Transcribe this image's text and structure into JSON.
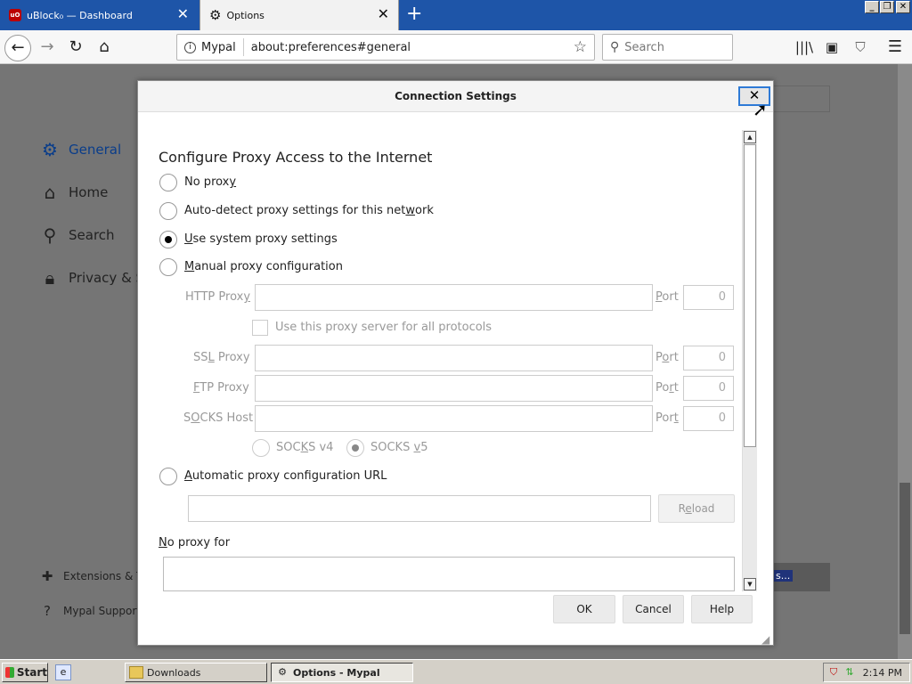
{
  "browser": {
    "tabs": [
      {
        "label": "uBlock₀ — Dashboard",
        "icon": "ublock-icon"
      },
      {
        "label": "Options",
        "icon": "gear-icon"
      }
    ],
    "new_tab": "+",
    "window_controls": {
      "minimize": "_",
      "restore": "❐",
      "close": "✕"
    },
    "identity": "Mypal",
    "url": "about:preferences#general",
    "search_placeholder": "Search"
  },
  "preferences": {
    "sidebar": [
      {
        "label": "General",
        "icon": "gear-icon",
        "selected": true
      },
      {
        "label": "Home",
        "icon": "home-icon"
      },
      {
        "label": "Search",
        "icon": "search-icon"
      },
      {
        "label": "Privacy & Se",
        "icon": "lock-icon"
      }
    ],
    "footer": [
      {
        "label": "Extensions & T",
        "icon": "puzzle-icon"
      },
      {
        "label": "Mypal Support",
        "icon": "help-icon"
      }
    ],
    "partial_button": "s..."
  },
  "dialog": {
    "title": "Connection Settings",
    "heading": "Configure Proxy Access to the Internet",
    "options": {
      "no_proxy": {
        "pre": "No prox",
        "key": "y",
        "post": ""
      },
      "auto_detect": {
        "pre": "Auto-detect proxy settings for this net",
        "key": "w",
        "post": "ork"
      },
      "system": {
        "pre": "",
        "key": "U",
        "post": "se system proxy settings"
      },
      "manual": {
        "pre": "",
        "key": "M",
        "post": "anual proxy configuration"
      },
      "auto_url": {
        "pre": "",
        "key": "A",
        "post": "utomatic proxy configuration URL"
      }
    },
    "selected_option": "system",
    "http_proxy": {
      "label": "HTTP Prox",
      "key": "y",
      "port_label_pre": "",
      "port_key": "P",
      "port_label_post": "ort",
      "port": "0"
    },
    "share": {
      "label": "Use this proxy server for all protocols"
    },
    "ssl_proxy": {
      "label_pre": "SS",
      "key": "L",
      "label_post": " Proxy",
      "port_label_pre": "P",
      "port_key": "o",
      "port_label_post": "rt",
      "port": "0"
    },
    "ftp_proxy": {
      "label_pre": "",
      "key": "F",
      "label_post": "TP Proxy",
      "port_label_pre": "Po",
      "port_key": "r",
      "port_label_post": "t",
      "port": "0"
    },
    "socks_host": {
      "label_pre": "S",
      "key": "O",
      "label_post": "CKS Host",
      "port_label_pre": "Por",
      "port_key": "t",
      "port_label_post": "",
      "port": "0"
    },
    "socks_v4": {
      "pre": "SOC",
      "key": "K",
      "post": "S v4"
    },
    "socks_v5": {
      "pre": "SOCKS ",
      "key": "v",
      "post": "5"
    },
    "socks_selected": "v5",
    "reload": {
      "pre": "R",
      "key": "e",
      "post": "load"
    },
    "no_proxy_for": {
      "pre": "",
      "key": "N",
      "post": "o proxy for"
    },
    "buttons": {
      "ok": "OK",
      "cancel": "Cancel",
      "help": "Help"
    },
    "close": "✕"
  },
  "taskbar": {
    "start": "Start",
    "items": [
      {
        "label": "Downloads",
        "active": false
      },
      {
        "label": "Options - Mypal",
        "active": true
      }
    ],
    "clock": "2:14 PM"
  }
}
